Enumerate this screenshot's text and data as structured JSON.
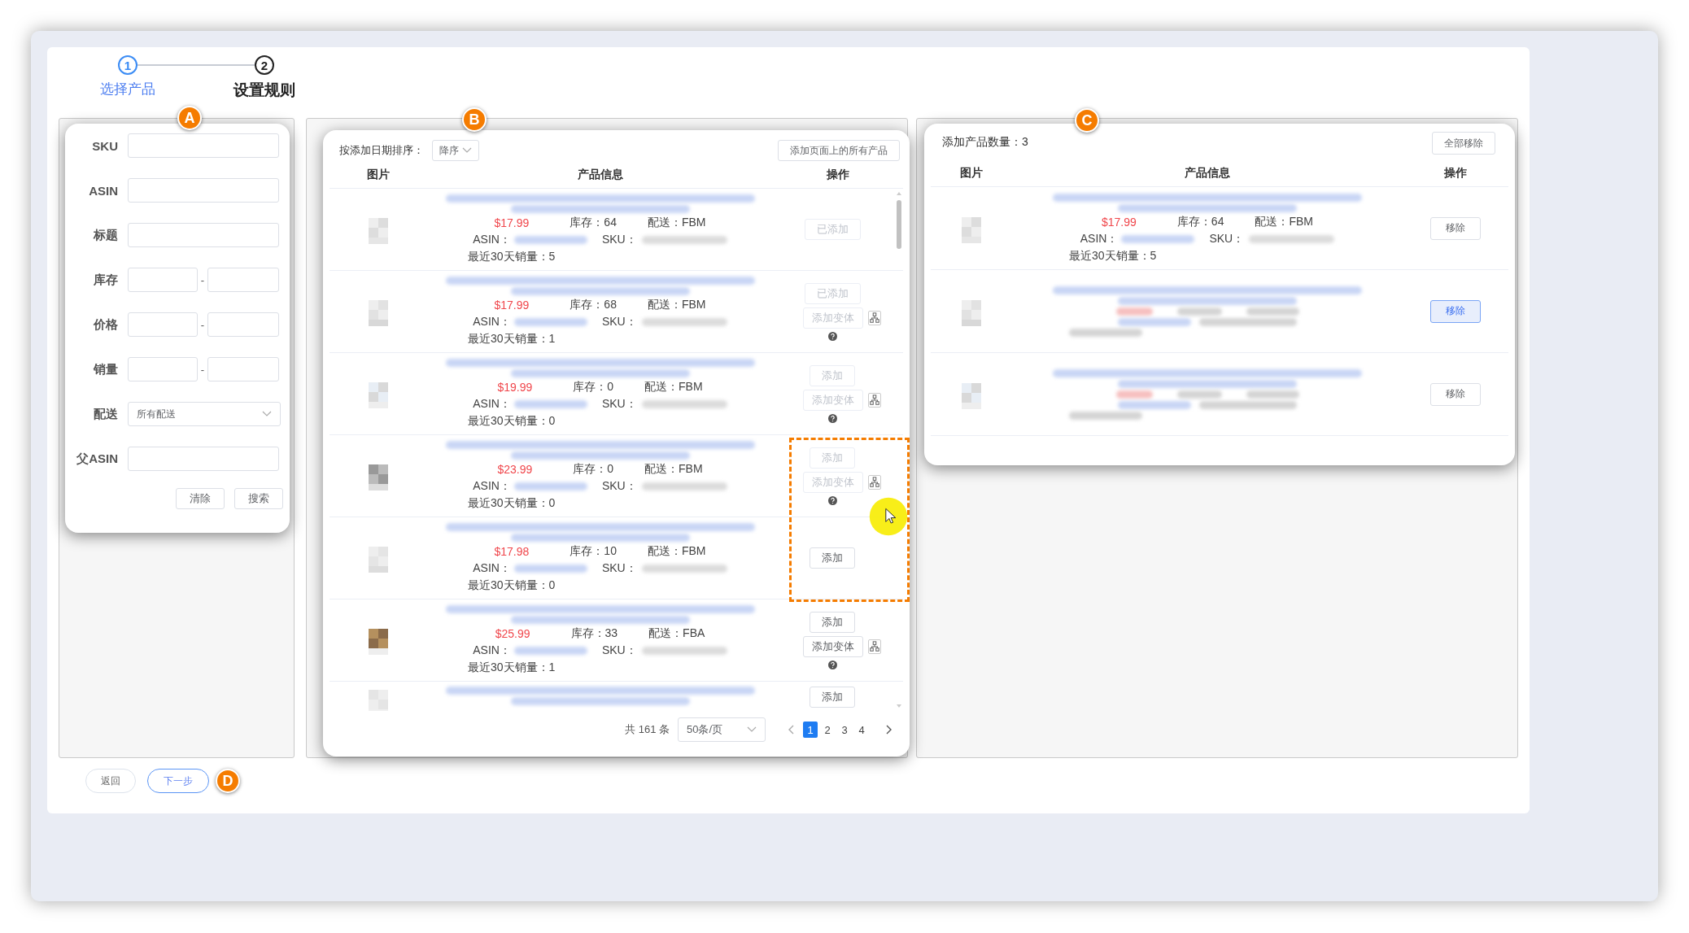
{
  "steps": [
    {
      "number": "1",
      "label": "选择产品",
      "selected": true
    },
    {
      "number": "2",
      "label": "设置规则",
      "selected": false
    }
  ],
  "badges": [
    {
      "letter": "A"
    },
    {
      "letter": "B"
    },
    {
      "letter": "C"
    },
    {
      "letter": "D"
    }
  ],
  "filter": {
    "fields": [
      {
        "label": "SKU",
        "kind": "text"
      },
      {
        "label": "ASIN",
        "kind": "text"
      },
      {
        "label": "标题",
        "kind": "text"
      },
      {
        "label": "库存",
        "kind": "range",
        "separator": "-"
      },
      {
        "label": "价格",
        "kind": "range",
        "separator": "-"
      },
      {
        "label": "销量",
        "kind": "range",
        "separator": "-"
      },
      {
        "label": "配送",
        "kind": "select",
        "value": "所有配送"
      },
      {
        "label": "父ASIN",
        "kind": "text"
      }
    ],
    "buttons": [
      "清除",
      "搜索"
    ]
  },
  "products": {
    "sort_label": "按添加日期排序：",
    "sort_value": "降序",
    "add_all": "添加页面上的所有产品",
    "columns": [
      "图片",
      "产品信息",
      "操作"
    ],
    "rows": [
      {
        "price": "$17.99",
        "stock": "库存：64",
        "shipping": "配送：FBM",
        "asin_label": "ASIN：",
        "sku_label": "SKU：",
        "sales": "最近30天销量：5",
        "actions": [
          {
            "kind": "add",
            "label": "已添加",
            "disabled": true
          }
        ]
      },
      {
        "price": "$17.99",
        "stock": "库存：68",
        "shipping": "配送：FBM",
        "asin_label": "ASIN：",
        "sku_label": "SKU：",
        "sales": "最近30天销量：1",
        "actions": [
          {
            "kind": "add",
            "label": "已添加",
            "disabled": true
          },
          {
            "kind": "variant",
            "label": "添加变体",
            "disabled": true
          }
        ]
      },
      {
        "price": "$19.99",
        "stock": "库存：0",
        "shipping": "配送：FBM",
        "asin_label": "ASIN：",
        "sku_label": "SKU：",
        "sales": "最近30天销量：0",
        "actions": [
          {
            "kind": "add",
            "label": "添加",
            "disabled": true
          },
          {
            "kind": "variant",
            "label": "添加变体",
            "disabled": true
          }
        ]
      },
      {
        "price": "$23.99",
        "stock": "库存：0",
        "shipping": "配送：FBM",
        "asin_label": "ASIN：",
        "sku_label": "SKU：",
        "sales": "最近30天销量：0",
        "actions": [
          {
            "kind": "add",
            "label": "添加",
            "disabled": true
          },
          {
            "kind": "variant",
            "label": "添加变体",
            "disabled": true
          }
        ]
      },
      {
        "price": "$17.98",
        "stock": "库存：10",
        "shipping": "配送：FBM",
        "asin_label": "ASIN：",
        "sku_label": "SKU：",
        "sales": "最近30天销量：0",
        "actions": [
          {
            "kind": "add",
            "label": "添加",
            "disabled": false
          }
        ]
      },
      {
        "price": "$25.99",
        "stock": "库存：33",
        "shipping": "配送：FBA",
        "asin_label": "ASIN：",
        "sku_label": "SKU：",
        "sales": "最近30天销量：1",
        "actions": [
          {
            "kind": "add",
            "label": "添加",
            "disabled": false
          },
          {
            "kind": "variant",
            "label": "添加变体",
            "disabled": false
          }
        ]
      },
      {
        "actions": [
          {
            "kind": "add",
            "label": "添加",
            "disabled": false
          }
        ]
      }
    ],
    "total": "共 161 条",
    "page_size": "50条/页",
    "pages": [
      {
        "label": "1",
        "selected": true
      },
      {
        "label": "2",
        "selected": false
      },
      {
        "label": "3",
        "selected": false
      },
      {
        "label": "4",
        "selected": false
      }
    ]
  },
  "selected": {
    "count_label": "添加产品数量：3",
    "remove_all": "全部移除",
    "columns": [
      "图片",
      "产品信息",
      "操作"
    ],
    "rows": [
      {
        "price": "$17.99",
        "stock": "库存：64",
        "shipping": "配送：FBM",
        "asin_label": "ASIN：",
        "sku_label": "SKU：",
        "sales": "最近30天销量：5",
        "remove": "移除",
        "highlighted": false
      },
      {
        "remove": "移除",
        "highlighted": true
      },
      {
        "remove": "移除",
        "highlighted": false
      }
    ]
  },
  "footer": {
    "buttons": [
      {
        "label": "返回",
        "primary": false
      },
      {
        "label": "下一步",
        "primary": true
      }
    ]
  }
}
